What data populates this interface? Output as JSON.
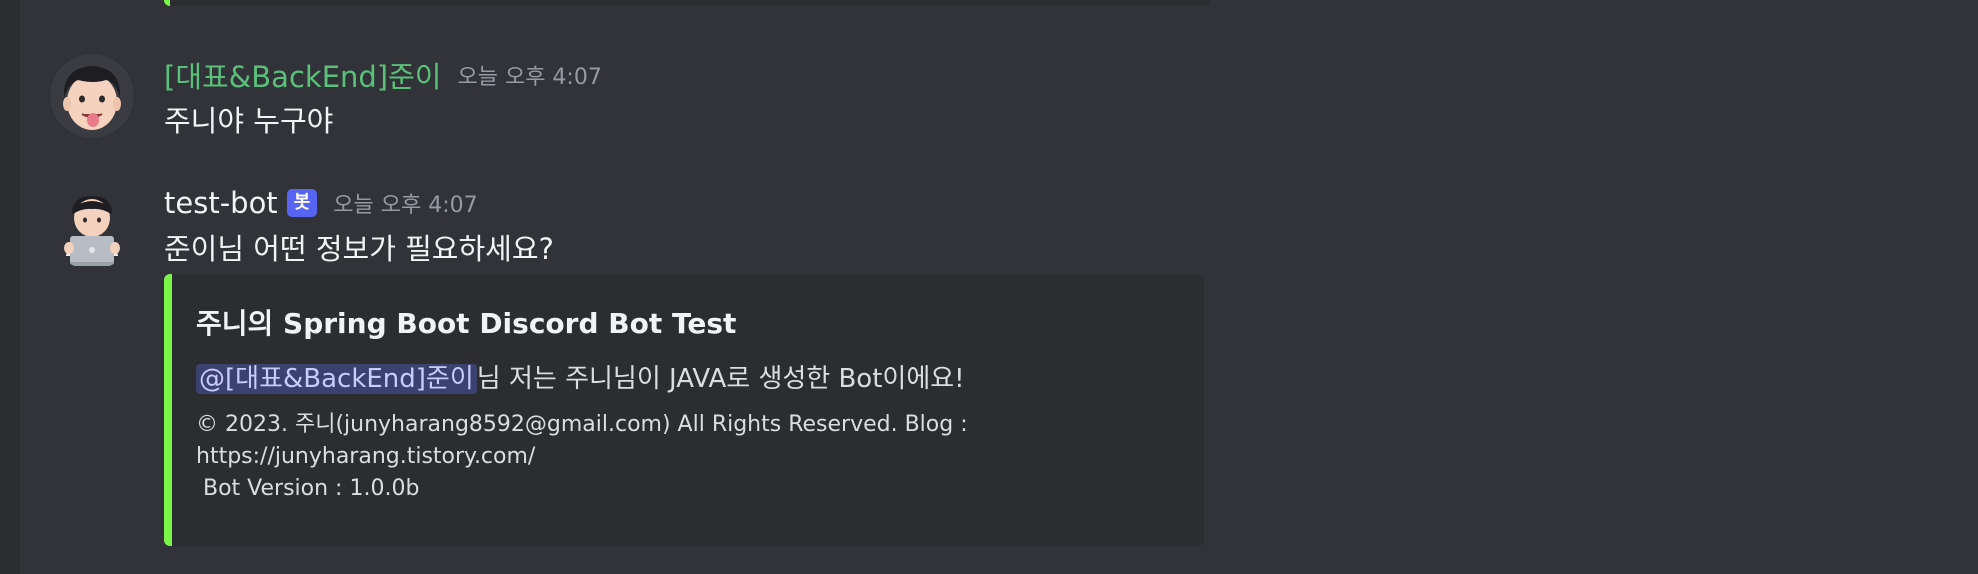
{
  "previous_embed": {
    "accent_color": "#7cf54a"
  },
  "messages": [
    {
      "author": "[대표&BackEnd]준이",
      "author_color": "#5bc07a",
      "avatar_icon": "memoji-tongue-avatar",
      "timestamp": "오늘 오후 4:07",
      "content": "주니야 누구야"
    },
    {
      "author": "test-bot",
      "author_color": "#f2f3f5",
      "bot_tag": "봇",
      "avatar_icon": "memoji-laptop-avatar",
      "timestamp": "오늘 오후 4:07",
      "content": "준이님 어떤 정보가 필요하세요?",
      "embed": {
        "accent_color": "#7cf54a",
        "title": "주니의 Spring Boot Discord Bot Test",
        "mention": "@[대표&BackEnd]준이",
        "description_rest": "님 저는 주니님이 JAVA로 생성한 Bot이에요!",
        "footer_lines": [
          "© 2023. 주니(junyharang8592@gmail.com) All Rights Reserved. Blog :",
          "https://junyharang.tistory.com/",
          " Bot Version : 1.0.0b"
        ]
      }
    }
  ]
}
